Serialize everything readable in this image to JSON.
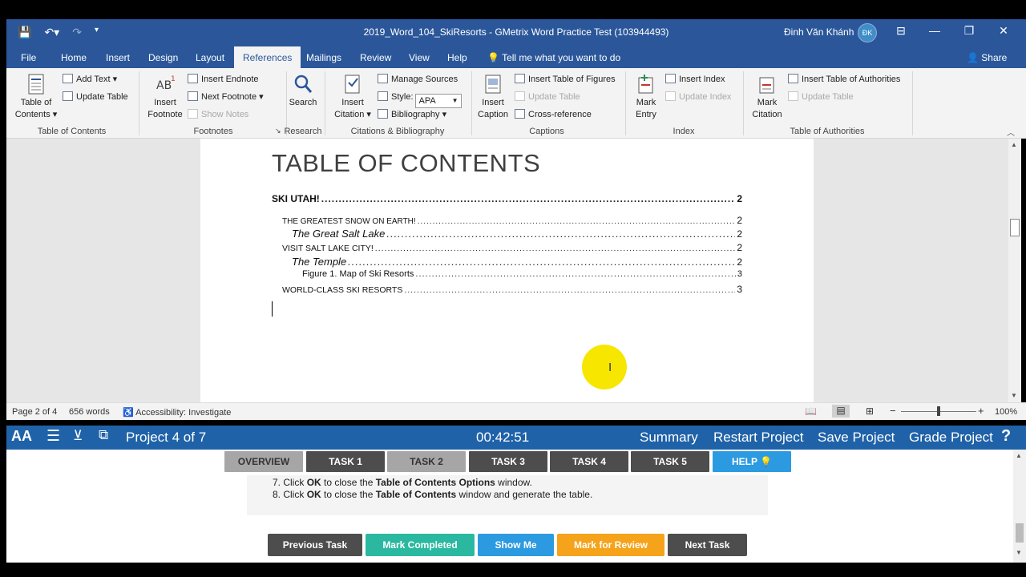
{
  "titlebar": {
    "title": "2019_Word_104_SkiResorts  -  GMetrix Word Practice Test (103944493)",
    "user": "Đinh Văn Khánh",
    "avatar_initials": "ĐK"
  },
  "tabs": [
    {
      "label": "File"
    },
    {
      "label": "Home"
    },
    {
      "label": "Insert"
    },
    {
      "label": "Design"
    },
    {
      "label": "Layout"
    },
    {
      "label": "References"
    },
    {
      "label": "Mailings"
    },
    {
      "label": "Review"
    },
    {
      "label": "View"
    },
    {
      "label": "Help"
    }
  ],
  "tell_me": "Tell me what you want to do",
  "share": "Share",
  "ribbon": {
    "toc": {
      "btn1": "Table of",
      "btn2": "Contents ▾",
      "add_text": "Add Text ▾",
      "update_table": "Update Table",
      "label": "Table of Contents"
    },
    "footnotes": {
      "insert1": "Insert",
      "insert2": "Footnote",
      "insert_endnote": "Insert Endnote",
      "next_footnote": "Next Footnote",
      "show_notes": "Show Notes",
      "label": "Footnotes"
    },
    "research": {
      "search": "Search",
      "label": "Research"
    },
    "citations": {
      "insert1": "Insert",
      "insert2": "Citation ▾",
      "manage_sources": "Manage Sources",
      "style_label": "Style:",
      "style_value": "APA",
      "bibliography": "Bibliography ▾",
      "label": "Citations & Bibliography"
    },
    "captions": {
      "insert1": "Insert",
      "insert2": "Caption",
      "insert_tof": "Insert Table of Figures",
      "update_table": "Update Table",
      "cross_reference": "Cross-reference",
      "label": "Captions"
    },
    "index": {
      "mark1": "Mark",
      "mark2": "Entry",
      "insert_index": "Insert Index",
      "update_index": "Update Index",
      "label": "Index"
    },
    "authorities": {
      "mark1": "Mark",
      "mark2": "Citation",
      "insert_toa": "Insert Table of Authorities",
      "update_table": "Update Table",
      "label": "Table of Authorities"
    }
  },
  "document": {
    "heading": "TABLE OF CONTENTS",
    "toc_entries": [
      {
        "text": "SKI UTAH!",
        "page": "2",
        "level": 1
      },
      {
        "text": "THE GREATEST SNOW ON EARTH!",
        "page": "2",
        "level": 2
      },
      {
        "text": "The Great Salt Lake",
        "page": "2",
        "level": 3
      },
      {
        "text": "VISIT SALT LAKE CITY!",
        "page": "2",
        "level": 2
      },
      {
        "text": "The Temple",
        "page": "2",
        "level": 3
      },
      {
        "text": "Figure 1. Map of Ski Resorts",
        "page": "3",
        "level": 4
      },
      {
        "text": "WORLD-CLASS SKI RESORTS",
        "page": "3",
        "level": 2
      }
    ]
  },
  "status": {
    "page": "Page 2 of 4",
    "words": "656 words",
    "accessibility": "Accessibility: Investigate",
    "zoom": "100%",
    "zoom_level": 1.0
  },
  "gmetrix": {
    "project": "Project 4 of 7",
    "timer": "00:42:51",
    "summary": "Summary",
    "restart": "Restart Project",
    "save": "Save Project",
    "grade": "Grade Project",
    "help_icon": "?"
  },
  "task_tabs": [
    {
      "label": "OVERVIEW",
      "color": "#a6a6a6",
      "text": "#333333"
    },
    {
      "label": "TASK 1",
      "color": "#4d4d4d",
      "text": "#ffffff"
    },
    {
      "label": "TASK 2",
      "color": "#a6a6a6",
      "text": "#333333"
    },
    {
      "label": "TASK 3",
      "color": "#4d4d4d",
      "text": "#ffffff"
    },
    {
      "label": "TASK 4",
      "color": "#4d4d4d",
      "text": "#ffffff"
    },
    {
      "label": "TASK 5",
      "color": "#4d4d4d",
      "text": "#ffffff"
    },
    {
      "label": "HELP 💡",
      "color": "#2c9ae0",
      "text": "#ffffff"
    }
  ],
  "instructions": [
    {
      "num": "7. Click ",
      "b1": "OK",
      "mid": " to close the ",
      "b2": "Table of Contents Options",
      "end": " window."
    },
    {
      "num": "8. Click ",
      "b1": "OK",
      "mid": " to close the ",
      "b2": "Table of Contents",
      "end": " window and generate the table."
    }
  ],
  "actions": [
    {
      "label": "Previous Task",
      "color": "#4d4d4d"
    },
    {
      "label": "Mark Completed",
      "color": "#2ab9a0"
    },
    {
      "label": "Show Me",
      "color": "#2c9ae0"
    },
    {
      "label": "Mark for Review",
      "color": "#f5a31a"
    },
    {
      "label": "Next Task",
      "color": "#4d4d4d"
    }
  ],
  "colors": {
    "word_blue": "#2b579a",
    "gmetrix_blue": "#1f62a8",
    "highlight": "#f7e600"
  }
}
